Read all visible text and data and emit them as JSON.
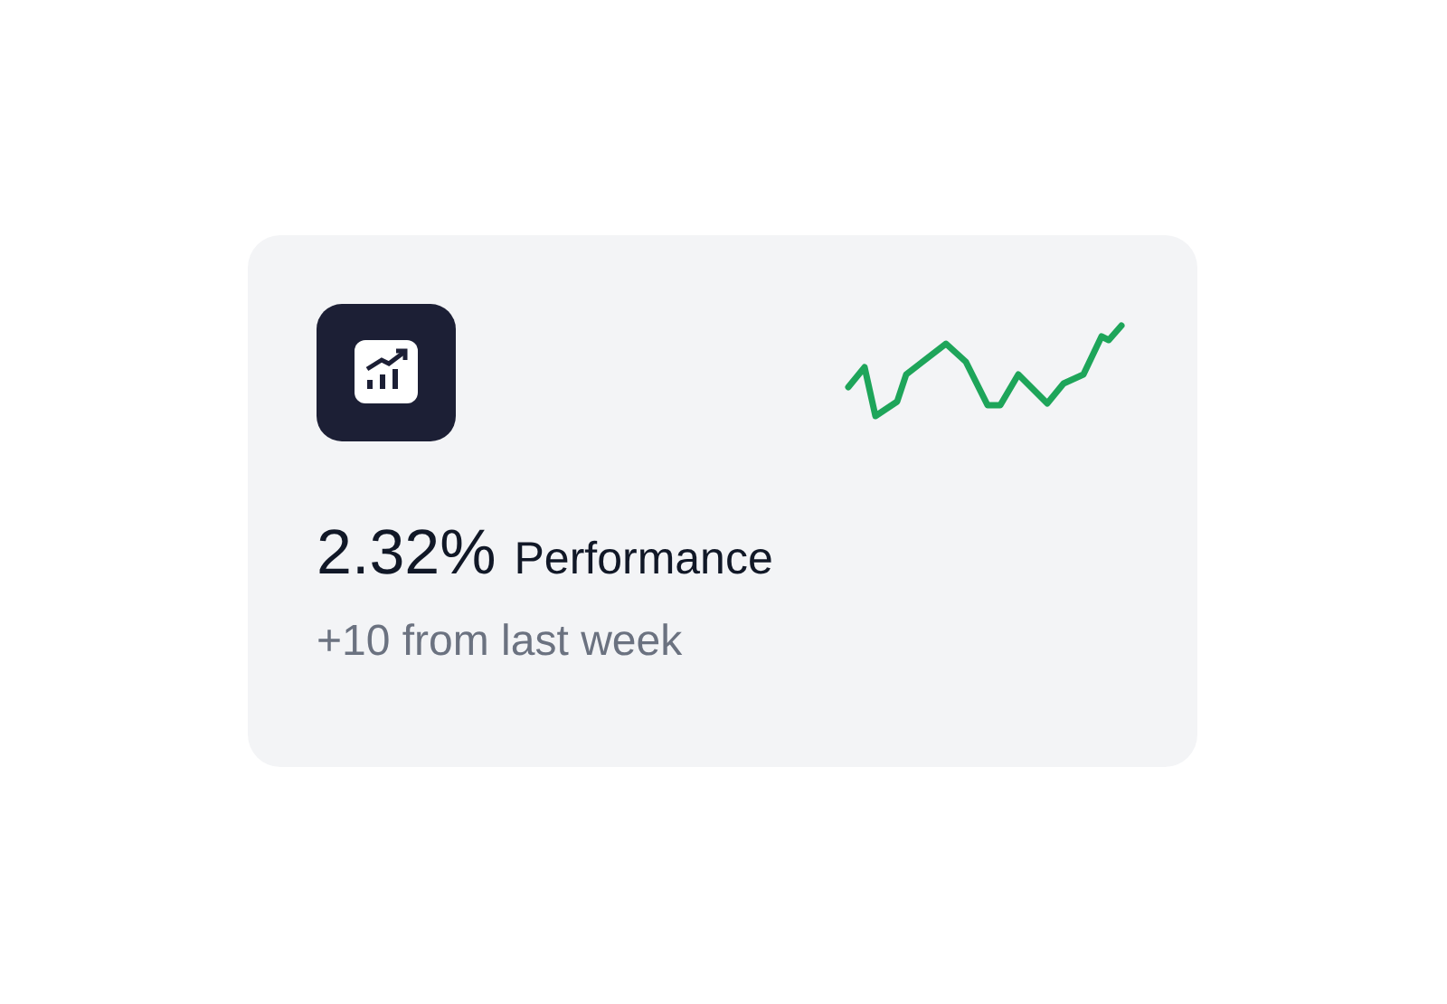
{
  "card": {
    "value": "2.32%",
    "label": "Performance",
    "change": "+10 from last week"
  }
}
